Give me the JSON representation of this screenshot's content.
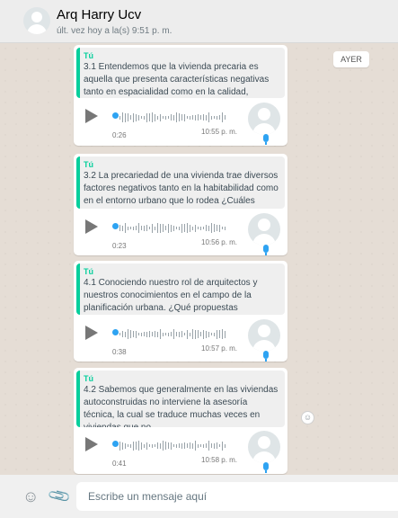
{
  "header": {
    "contact_name": "Arq Harry Ucv",
    "last_seen": "últ. vez hoy a la(s) 9:51 p. m."
  },
  "chat": {
    "day_badge": "AYER",
    "reaction_icon": "smiley-icon",
    "messages": [
      {
        "quote_author": "Tú",
        "quote_text": "3.1 Entendemos que la vivienda precaria es aquella que presenta características negativas tanto en espacialidad como en la calidad, ¿Cuáles ...",
        "duration": "0:26",
        "time": "10:55 p. m."
      },
      {
        "quote_author": "Tú",
        "quote_text": "3.2 La precariedad de una vivienda trae diversos factores negativos tanto en la habitabilidad como en el entorno urbano que lo rodea ¿Cuáles serían l...",
        "duration": "0:23",
        "time": "10:56 p. m."
      },
      {
        "quote_author": "Tú",
        "quote_text": "4.1 Conociendo nuestro rol de arquitectos y nuestros conocimientos en el campo de la planificación urbana. ¿Qué propuestas urbanísticas...",
        "duration": "0:38",
        "time": "10:57 p. m."
      },
      {
        "quote_author": "Tú",
        "quote_text": "4.2 Sabemos que generalmente en las viviendas autoconstruidas no interviene la asesoría técnica, la cual se traduce muchas veces en viviendas que no ...",
        "duration": "0:41",
        "time": "10:58 p. m."
      }
    ]
  },
  "footer": {
    "emoji_icon": "smiley-icon",
    "attach_icon": "paperclip-icon",
    "input_placeholder": "Escribe un mensaje aquí"
  },
  "colors": {
    "accent": "#06cf9c",
    "chat_bg": "#e5ddd5",
    "audio_dot": "#2ea3f2"
  }
}
